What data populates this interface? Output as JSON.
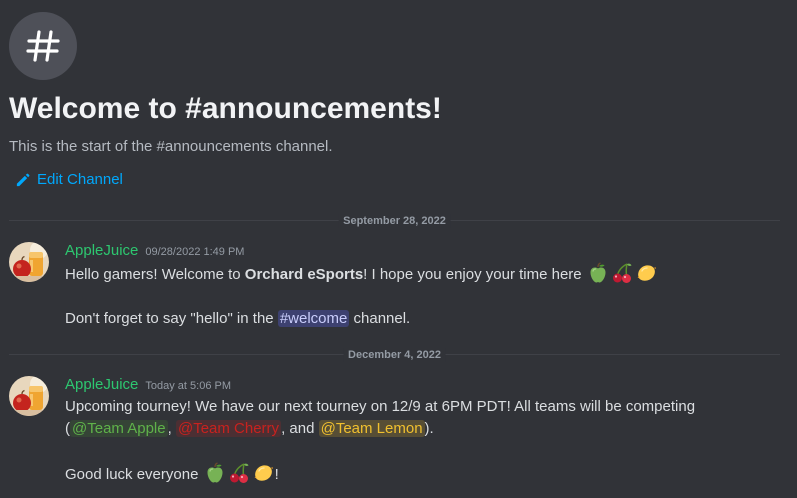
{
  "channel": {
    "icon": "hashtag-icon",
    "welcome_title": "Welcome to #announcements!",
    "welcome_subtitle": "This is the start of the #announcements channel.",
    "edit_label": "Edit Channel"
  },
  "dividers": [
    {
      "label": "September 28, 2022"
    },
    {
      "label": "December 4, 2022"
    }
  ],
  "messages": [
    {
      "author": "AppleJuice",
      "timestamp": "09/28/2022 1:49 PM",
      "line1_a": "Hello gamers! Welcome to ",
      "line1_bold": "Orchard eSports",
      "line1_b": "! I hope you enjoy your time here",
      "line2_a": "Don't forget to say \"hello\" in the ",
      "line2_mention": "#welcome",
      "line2_b": " channel."
    },
    {
      "author": "AppleJuice",
      "timestamp": "Today at 5:06 PM",
      "line1": "Upcoming tourney! We have our next tourney on 12/9 at 6PM PDT! All teams will be competing",
      "line2_open": "(",
      "role_apple": "@Team Apple",
      "sep1": ", ",
      "role_cherry": "@Team Cherry",
      "sep2": ", and ",
      "role_lemon": "@Team Lemon",
      "line2_close": ").",
      "line3_a": "Good luck everyone",
      "line3_b": "!"
    }
  ],
  "colors": {
    "background": "#313338",
    "username": "#2dc770",
    "link": "#00a8fc",
    "team_apple": "#5fb24a",
    "team_cherry": "#c8221f",
    "team_lemon": "#f0c02f"
  },
  "emojis": [
    "green-apple-emoji",
    "cherries-emoji",
    "lemon-emoji"
  ]
}
